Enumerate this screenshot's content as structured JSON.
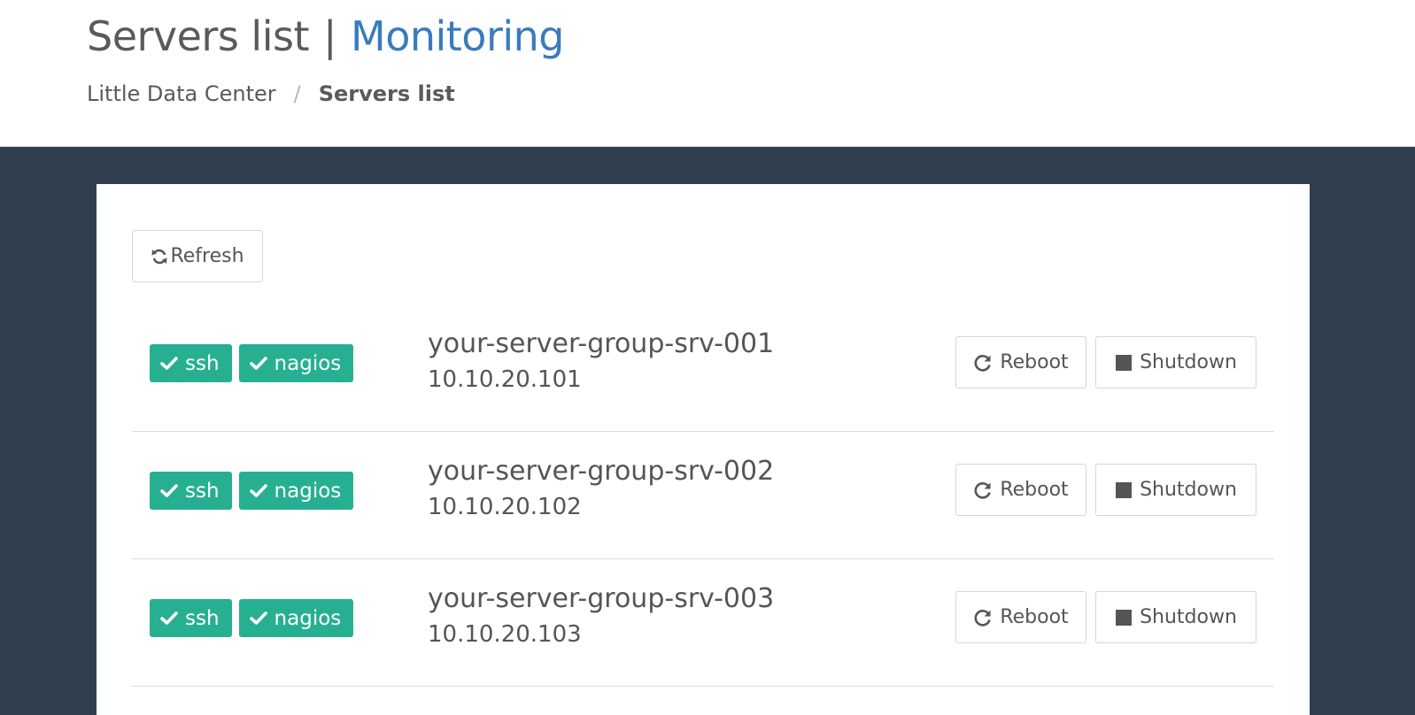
{
  "header": {
    "title_main": "Servers list",
    "title_separator": "|",
    "title_accent": "Monitoring",
    "breadcrumb": {
      "root": "Little Data Center",
      "separator": "/",
      "current": "Servers list"
    }
  },
  "toolbar": {
    "refresh_label": "Refresh",
    "refresh_icon": "refresh-icon"
  },
  "colors": {
    "background": "#2f3f4f",
    "badge": "#26b091",
    "accent": "#3a7bbd"
  },
  "servers": [
    {
      "badges": [
        {
          "label": "ssh",
          "icon": "check-icon"
        },
        {
          "label": "nagios",
          "icon": "check-icon"
        }
      ],
      "hostname": "your-server-group-srv-001",
      "ip": "10.10.20.101",
      "reboot_label": "Reboot",
      "shutdown_label": "Shutdown"
    },
    {
      "badges": [
        {
          "label": "ssh",
          "icon": "check-icon"
        },
        {
          "label": "nagios",
          "icon": "check-icon"
        }
      ],
      "hostname": "your-server-group-srv-002",
      "ip": "10.10.20.102",
      "reboot_label": "Reboot",
      "shutdown_label": "Shutdown"
    },
    {
      "badges": [
        {
          "label": "ssh",
          "icon": "check-icon"
        },
        {
          "label": "nagios",
          "icon": "check-icon"
        }
      ],
      "hostname": "your-server-group-srv-003",
      "ip": "10.10.20.103",
      "reboot_label": "Reboot",
      "shutdown_label": "Shutdown"
    }
  ]
}
